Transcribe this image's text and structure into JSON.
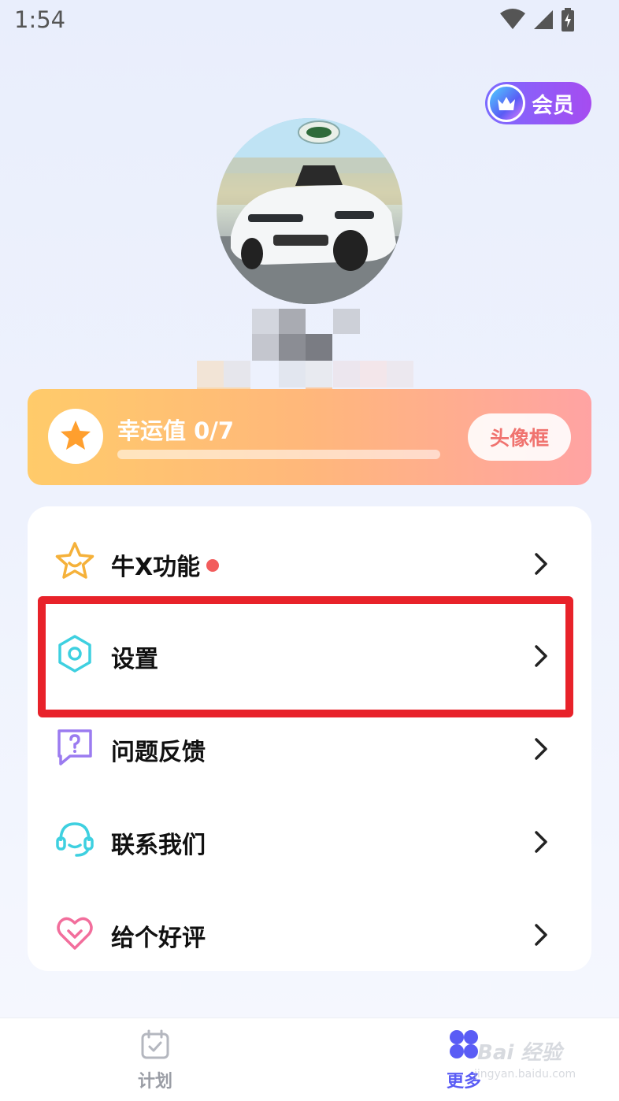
{
  "status_bar": {
    "time": "1:54"
  },
  "vip_badge": {
    "label": "会员"
  },
  "lucky_card": {
    "title": "幸运值 0/7",
    "progress": 0,
    "frame_button": "头像框"
  },
  "menu": {
    "items": [
      {
        "label": "牛X功能",
        "icon": "star-icon",
        "has_dot": true
      },
      {
        "label": "设置",
        "icon": "settings-hex-icon"
      },
      {
        "label": "问题反馈",
        "icon": "feedback-question-icon"
      },
      {
        "label": "联系我们",
        "icon": "headset-icon"
      },
      {
        "label": "给个好评",
        "icon": "heart-icon"
      }
    ]
  },
  "tab_bar": {
    "tabs": [
      {
        "label": "计划",
        "icon": "calendar-check-icon",
        "active": false
      },
      {
        "label": "更多",
        "icon": "four-petal-icon",
        "active": true
      }
    ]
  },
  "watermark": {
    "brand": "Bai 经验",
    "sub": "jingyan.baidu.com"
  },
  "colors": {
    "accent": "#5a5cf5",
    "highlight": "#e8222a",
    "dot": "#f25c5c",
    "frame_button_text": "#f0736f"
  }
}
